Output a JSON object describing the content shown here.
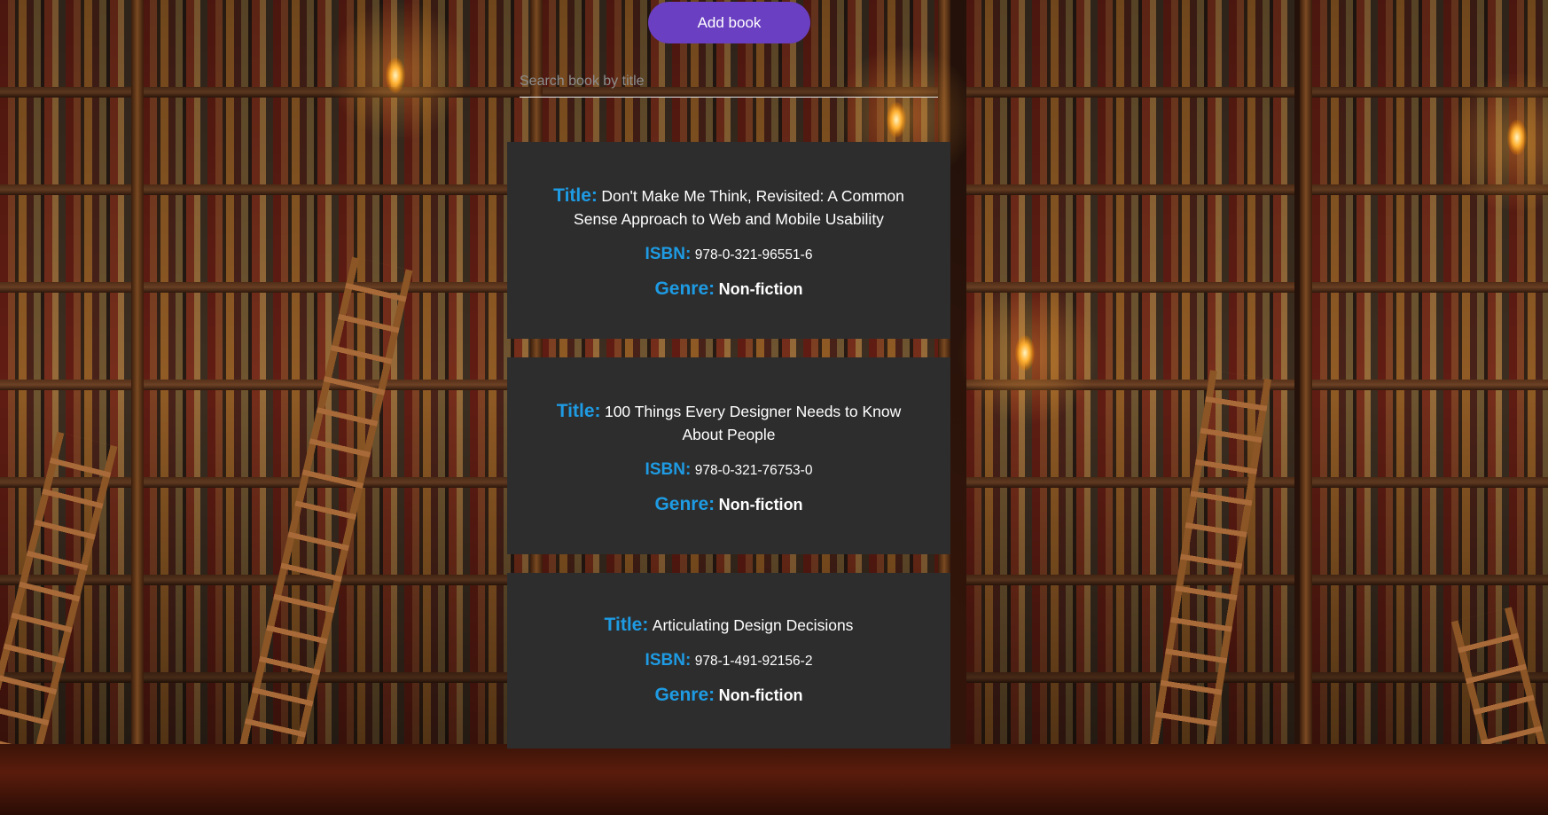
{
  "toolbar": {
    "add_label": "Add book",
    "button_color": "#6a3fc1"
  },
  "search": {
    "placeholder": "Search book by title",
    "value": ""
  },
  "labels": {
    "title": "Title:",
    "isbn": "ISBN:",
    "genre": "Genre:",
    "label_color": "#1e9be3"
  },
  "books": [
    {
      "title": "Don't Make Me Think, Revisited: A Common Sense Approach to Web and Mobile Usability",
      "isbn": "978-0-321-96551-6",
      "genre": "Non-fiction"
    },
    {
      "title": "100 Things Every Designer Needs to Know About People",
      "isbn": "978-0-321-76753-0",
      "genre": "Non-fiction"
    },
    {
      "title": "Articulating Design Decisions",
      "isbn": "978-1-491-92156-2",
      "genre": "Non-fiction"
    }
  ],
  "background": {
    "image": "library-bookshelves-background"
  }
}
